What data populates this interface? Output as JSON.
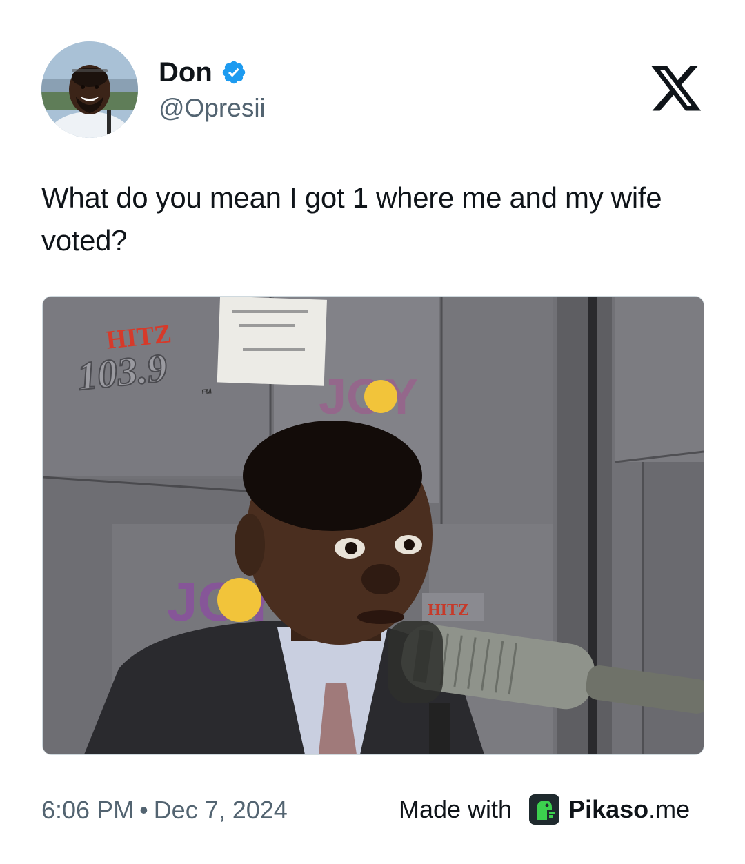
{
  "tweet": {
    "author": {
      "display_name": "Don",
      "handle": "@Opresii",
      "verified": true,
      "avatar_icon": "avatar-smiling-man"
    },
    "platform_icon": "x-logo-icon",
    "text": "What do you mean I got 1 where me and my wife voted?",
    "media": {
      "description_icon": "photo-man-at-radio-microphone",
      "studio_signs": {
        "hitz_top": "HITZ",
        "hitz_number": "103.9",
        "hitz_fm": "FM",
        "joy": "JOY",
        "hitz_small": "HITZ"
      }
    },
    "time": "6:06 PM",
    "separator": "•",
    "date": "Dec 7, 2024"
  },
  "footer": {
    "made_with_label": "Made with",
    "brand_icon": "pikaso-dino-icon",
    "brand_name": "Pikaso",
    "brand_tld": ".me"
  },
  "colors": {
    "text_primary": "#0f1419",
    "text_secondary": "#536471",
    "verified_blue": "#1d9bf0",
    "border": "#cfd9de",
    "pikaso_green": "#3ccf4e"
  }
}
